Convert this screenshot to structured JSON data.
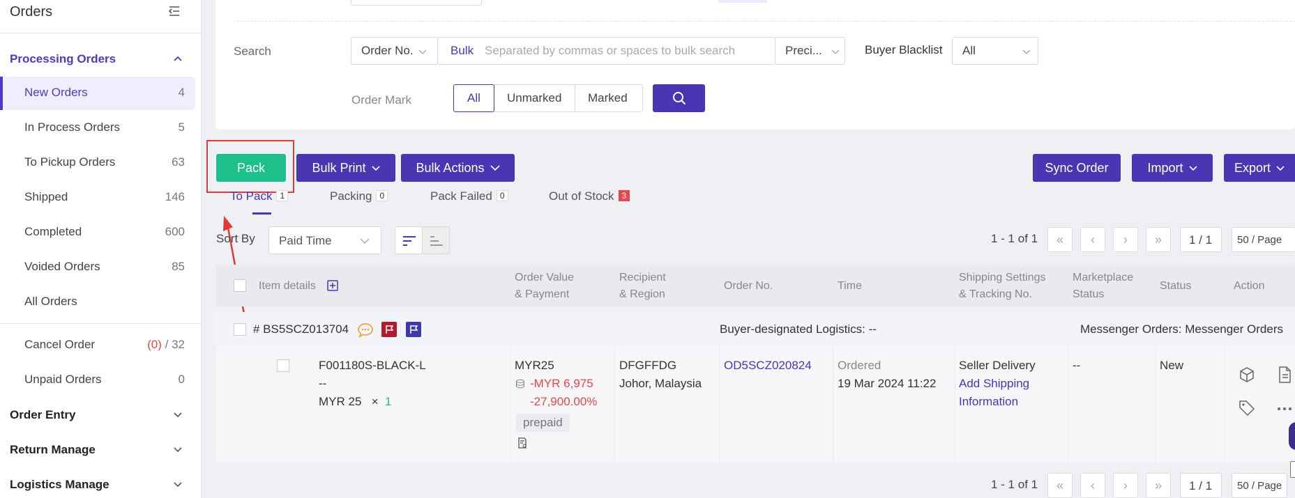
{
  "sidebar": {
    "title": "Orders",
    "groups": {
      "processing": "Processing Orders",
      "order_entry": "Order Entry",
      "return_manage": "Return Manage",
      "logistics_manage": "Logistics Manage"
    },
    "items": [
      {
        "label": "New Orders",
        "count": "4"
      },
      {
        "label": "In Process Orders",
        "count": "5"
      },
      {
        "label": "To Pickup Orders",
        "count": "63"
      },
      {
        "label": "Shipped",
        "count": "146"
      },
      {
        "label": "Completed",
        "count": "600"
      },
      {
        "label": "Voided Orders",
        "count": "85"
      },
      {
        "label": "All Orders",
        "count": ""
      }
    ],
    "cancel_order": {
      "label": "Cancel Order",
      "count_red": "(0)",
      "count_total": "/ 32"
    },
    "unpaid_orders": {
      "label": "Unpaid Orders",
      "count": "0"
    }
  },
  "filters": {
    "search_label": "Search",
    "search_type": "Order No.",
    "bulk_label": "Bulk",
    "search_placeholder": "Separated by commas or spaces to bulk search",
    "precision": "Preci...",
    "blacklist_label": "Buyer Blacklist",
    "blacklist_value": "All",
    "order_mark_label": "Order Mark",
    "order_mark_options": [
      "All",
      "Unmarked",
      "Marked"
    ]
  },
  "toolbar": {
    "pack": "Pack",
    "bulk_print": "Bulk Print",
    "bulk_actions": "Bulk Actions",
    "sync_order": "Sync Order",
    "import": "Import",
    "export": "Export"
  },
  "subtabs": [
    {
      "label": "To Pack",
      "count": "1"
    },
    {
      "label": "Packing",
      "count": "0"
    },
    {
      "label": "Pack Failed",
      "count": "0"
    },
    {
      "label": "Out of Stock",
      "count": "3"
    }
  ],
  "sort": {
    "label": "Sort By",
    "value": "Paid Time"
  },
  "pagination": {
    "range": "1 - 1 of 1",
    "page": "1 / 1",
    "page_size": "50 / Page"
  },
  "table": {
    "headers": {
      "item_details": "Item details",
      "order_value_1": "Order Value",
      "order_value_2": "& Payment",
      "recipient_1": "Recipient",
      "recipient_2": "& Region",
      "order_no": "Order No.",
      "time": "Time",
      "shipping_1": "Shipping Settings",
      "shipping_2": "& Tracking No.",
      "marketplace_1": "Marketplace",
      "marketplace_2": "Status",
      "status": "Status",
      "action": "Action"
    },
    "order": {
      "id": "# BS5SCZ013704",
      "logistics": "Buyer-designated Logistics: --",
      "messenger": "Messenger Orders: Messenger Orders",
      "sku": "F001180S-BLACK-L",
      "variant": "--",
      "price": "MYR 25",
      "qty_x": "×",
      "qty": "1",
      "order_value": "MYR25",
      "profit": "-MYR 6,975",
      "profit_pct": "-27,900.00%",
      "payment": "prepaid",
      "recipient": "DFGFFDG",
      "region": "Johor, Malaysia",
      "order_no": "OD5SCZ020824",
      "time_label": "Ordered",
      "time_value": "19 Mar 2024 11:22",
      "shipping": "Seller Delivery",
      "add_shipping_1": "Add Shipping",
      "add_shipping_2": "Information",
      "marketplace_status": "--",
      "status": "New"
    }
  },
  "colors": {
    "accent": "#4a36b3",
    "pack": "#1dbf8a",
    "highlight": "#e53935"
  }
}
